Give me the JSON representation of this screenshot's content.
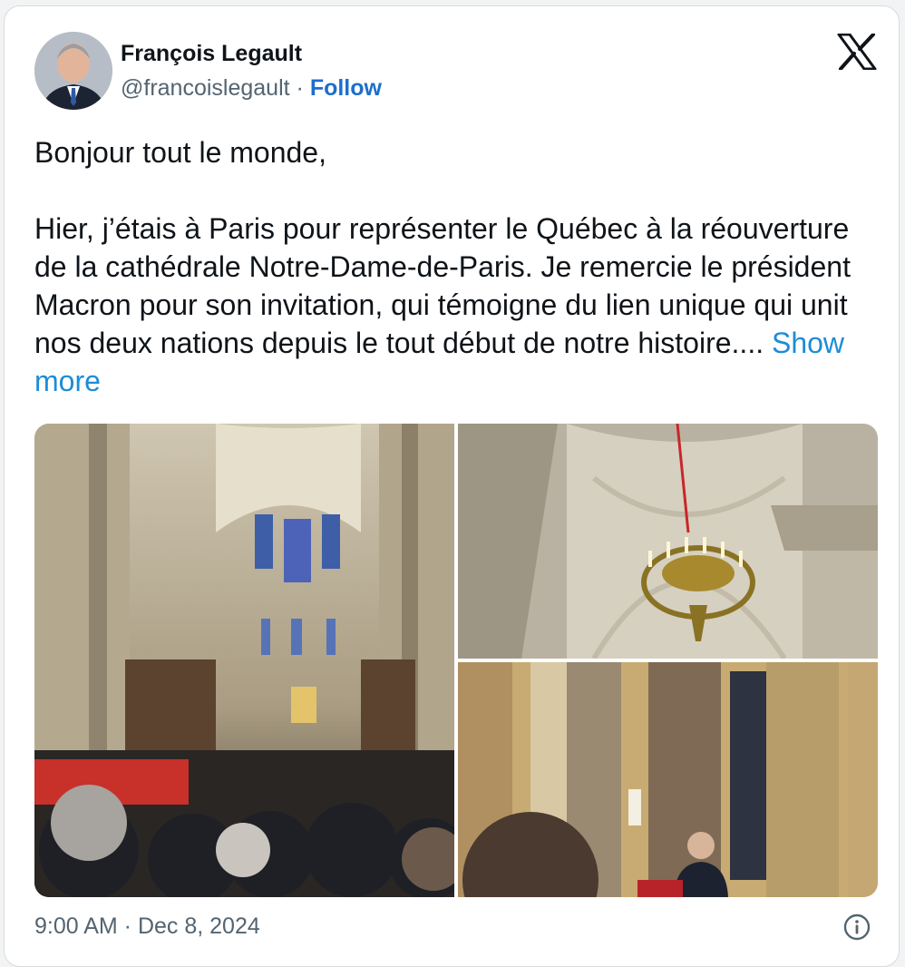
{
  "author": {
    "name": "François Legault",
    "handle": "@francoislegault",
    "separator": " · ",
    "follow_label": "Follow"
  },
  "tweet": {
    "paragraphs": [
      "Bonjour tout le monde,",
      "Hier, j’étais à Paris pour représenter le Québec à la réouverture de la cathédrale Notre-Dame-de-Paris. Je remercie le président Macron pour son invitation, qui témoigne du lien unique qui unit nos deux nations depuis le tout début de notre histoire.... "
    ],
    "show_more_label": "Show more"
  },
  "timestamp": "9:00 AM · Dec 8, 2024",
  "icons": {
    "brand": "x-logo-icon",
    "info": "info-icon"
  },
  "colors": {
    "follow": "#1d6fc9",
    "link": "#1d8cd8",
    "text": "#0f1419",
    "muted": "#536471"
  }
}
